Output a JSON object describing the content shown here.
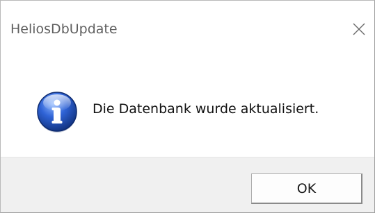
{
  "window": {
    "title": "HeliosDbUpdate",
    "close_icon": "close-icon"
  },
  "dialog": {
    "icon": "info-icon",
    "message": "Die Datenbank wurde aktualisiert."
  },
  "buttons": {
    "ok_label": "OK"
  },
  "colors": {
    "footer_background": "#f0f0f0",
    "icon_blue": "#1f4fb0"
  }
}
